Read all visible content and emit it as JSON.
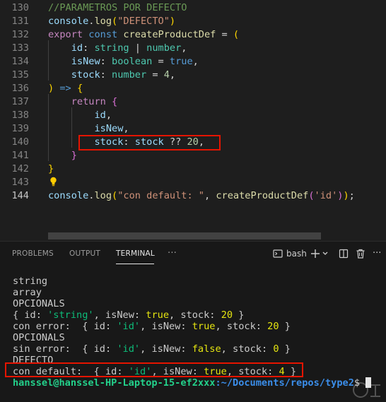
{
  "editor": {
    "lines": [
      {
        "num": "130",
        "parts": [
          {
            "t": "//PARAMETROS POR DEFECTO",
            "c": "cmt"
          }
        ]
      },
      {
        "num": "131",
        "parts": [
          {
            "t": "console",
            "c": "var"
          },
          {
            "t": "."
          },
          {
            "t": "log",
            "c": "fn"
          },
          {
            "t": "(",
            "c": "p1"
          },
          {
            "t": "\"DEFECTO\"",
            "c": "str"
          },
          {
            "t": ")",
            "c": "p1"
          }
        ]
      },
      {
        "num": "132",
        "parts": [
          {
            "t": "export",
            "c": "ctl"
          },
          {
            "t": " "
          },
          {
            "t": "const",
            "c": "kw"
          },
          {
            "t": " "
          },
          {
            "t": "createProductDef",
            "c": "fn"
          },
          {
            "t": " = "
          },
          {
            "t": "(",
            "c": "p1"
          }
        ]
      },
      {
        "num": "133",
        "parts": [
          {
            "t": "    "
          },
          {
            "t": "id",
            "c": "var"
          },
          {
            "t": ": "
          },
          {
            "t": "string",
            "c": "typ"
          },
          {
            "t": " | "
          },
          {
            "t": "number",
            "c": "typ"
          },
          {
            "t": ","
          }
        ]
      },
      {
        "num": "134",
        "parts": [
          {
            "t": "    "
          },
          {
            "t": "isNew",
            "c": "var"
          },
          {
            "t": ": "
          },
          {
            "t": "boolean",
            "c": "typ"
          },
          {
            "t": " = "
          },
          {
            "t": "true",
            "c": "kw"
          },
          {
            "t": ","
          }
        ]
      },
      {
        "num": "135",
        "parts": [
          {
            "t": "    "
          },
          {
            "t": "stock",
            "c": "var"
          },
          {
            "t": ": "
          },
          {
            "t": "number",
            "c": "typ"
          },
          {
            "t": " = "
          },
          {
            "t": "4",
            "c": "num"
          },
          {
            "t": ","
          }
        ]
      },
      {
        "num": "136",
        "parts": [
          {
            "t": ")",
            "c": "p1"
          },
          {
            "t": " "
          },
          {
            "t": "=>",
            "c": "kw"
          },
          {
            "t": " "
          },
          {
            "t": "{",
            "c": "p1"
          }
        ]
      },
      {
        "num": "137",
        "parts": [
          {
            "t": "    "
          },
          {
            "t": "return",
            "c": "ctl"
          },
          {
            "t": " "
          },
          {
            "t": "{",
            "c": "p2"
          }
        ]
      },
      {
        "num": "138",
        "parts": [
          {
            "t": "        "
          },
          {
            "t": "id",
            "c": "var"
          },
          {
            "t": ","
          }
        ]
      },
      {
        "num": "139",
        "parts": [
          {
            "t": "        "
          },
          {
            "t": "isNew",
            "c": "var"
          },
          {
            "t": ","
          }
        ]
      },
      {
        "num": "140",
        "parts": [
          {
            "t": "        "
          },
          {
            "t": "stock",
            "c": "var"
          },
          {
            "t": ": "
          },
          {
            "t": "stock",
            "c": "var"
          },
          {
            "t": " ?? "
          },
          {
            "t": "20",
            "c": "num"
          },
          {
            "t": ","
          }
        ]
      },
      {
        "num": "141",
        "parts": [
          {
            "t": "    "
          },
          {
            "t": "}",
            "c": "p2"
          }
        ]
      },
      {
        "num": "142",
        "parts": [
          {
            "t": "}",
            "c": "p1"
          }
        ]
      },
      {
        "num": "143",
        "parts": []
      },
      {
        "num": "144",
        "parts": [
          {
            "t": "console",
            "c": "var"
          },
          {
            "t": "."
          },
          {
            "t": "log",
            "c": "fn"
          },
          {
            "t": "(",
            "c": "p1"
          },
          {
            "t": "\"con default: \"",
            "c": "str"
          },
          {
            "t": ", "
          },
          {
            "t": "createProductDef",
            "c": "fn"
          },
          {
            "t": "(",
            "c": "p2"
          },
          {
            "t": "'id'",
            "c": "str"
          },
          {
            "t": ")",
            "c": "p2"
          },
          {
            "t": ")",
            "c": "p1"
          },
          {
            "t": ";"
          }
        ]
      }
    ],
    "current_line": "144"
  },
  "panel": {
    "tabs": [
      "PROBLEMS",
      "OUTPUT",
      "TERMINAL"
    ],
    "more_label": "···",
    "shell_label": "bash",
    "icons": [
      "terminal-icon",
      "plus-icon",
      "chevron-down-icon",
      "split-terminal-icon",
      "trash-icon",
      "more-icon"
    ]
  },
  "terminal": {
    "lines": [
      [
        {
          "t": "string"
        }
      ],
      [
        {
          "t": "array"
        }
      ],
      [
        {
          "t": "OPCIONALS"
        }
      ],
      [
        {
          "t": "{ id: "
        },
        {
          "t": "'string'",
          "c": "t-str"
        },
        {
          "t": ", isNew: "
        },
        {
          "t": "true",
          "c": "t-bool"
        },
        {
          "t": ", stock: "
        },
        {
          "t": "20",
          "c": "t-num"
        },
        {
          "t": " }"
        }
      ],
      [
        {
          "t": "con error:  { id: "
        },
        {
          "t": "'id'",
          "c": "t-str"
        },
        {
          "t": ", isNew: "
        },
        {
          "t": "true",
          "c": "t-bool"
        },
        {
          "t": ", stock: "
        },
        {
          "t": "20",
          "c": "t-num"
        },
        {
          "t": " }"
        }
      ],
      [
        {
          "t": "OPCIONALS"
        }
      ],
      [
        {
          "t": "sin error:  { id: "
        },
        {
          "t": "'id'",
          "c": "t-str"
        },
        {
          "t": ", isNew: "
        },
        {
          "t": "false",
          "c": "t-bool"
        },
        {
          "t": ", stock: "
        },
        {
          "t": "0",
          "c": "t-num"
        },
        {
          "t": " }"
        }
      ],
      [
        {
          "t": "DEFECTO"
        }
      ],
      [
        {
          "t": "con default:  { id: "
        },
        {
          "t": "'id'",
          "c": "t-str"
        },
        {
          "t": ", isNew: "
        },
        {
          "t": "true",
          "c": "t-bool"
        },
        {
          "t": ", stock: "
        },
        {
          "t": "4",
          "c": "t-num"
        },
        {
          "t": " }"
        }
      ]
    ],
    "prompt_user": "hanssel@hanssel-HP-Laptop-15-ef2xxx",
    "prompt_path": ":~/Documents/repos/type2",
    "prompt_symbol": "$ "
  },
  "colors": {
    "highlight_box": "#e51400",
    "editor_bg": "#1e1e1e",
    "panel_bg": "#181818"
  }
}
